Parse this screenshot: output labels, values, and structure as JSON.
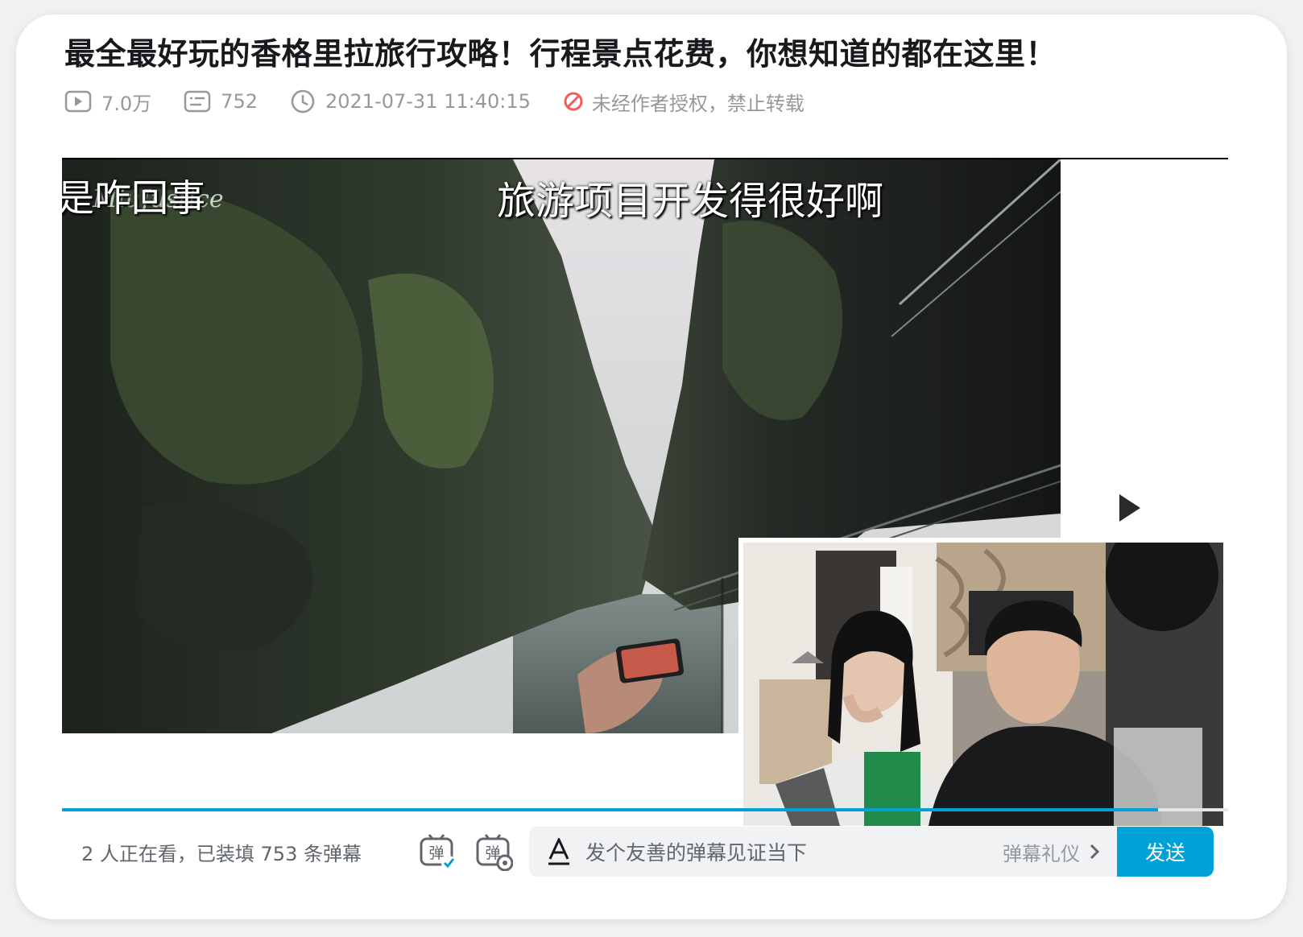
{
  "video": {
    "title": "最全最好玩的香格里拉旅行攻略！行程景点花费，你想知道的都在这里！",
    "views": "7.0万",
    "danmaku_count": "752",
    "published_at": "2021-07-31 11:40:15",
    "copyright_notice": "未经作者授权，禁止转载"
  },
  "player": {
    "caption_left": "是咋回事",
    "caption_center": "旅游项目开发得很好啊",
    "watermark": "MiuJustice",
    "progress_fraction": 0.94
  },
  "bar": {
    "viewers_text": "2 人正在看，已装填 753 条弹幕",
    "danmaku_toggle_glyph": "弹",
    "danmaku_settings_glyph": "弹",
    "input_placeholder": "发个友善的弹幕见证当下",
    "etiquette_label": "弹幕礼仪",
    "send_label": "发送"
  },
  "colors": {
    "accent": "#00a1d6",
    "warn": "#f25d59",
    "meta_text": "#9499a0"
  }
}
